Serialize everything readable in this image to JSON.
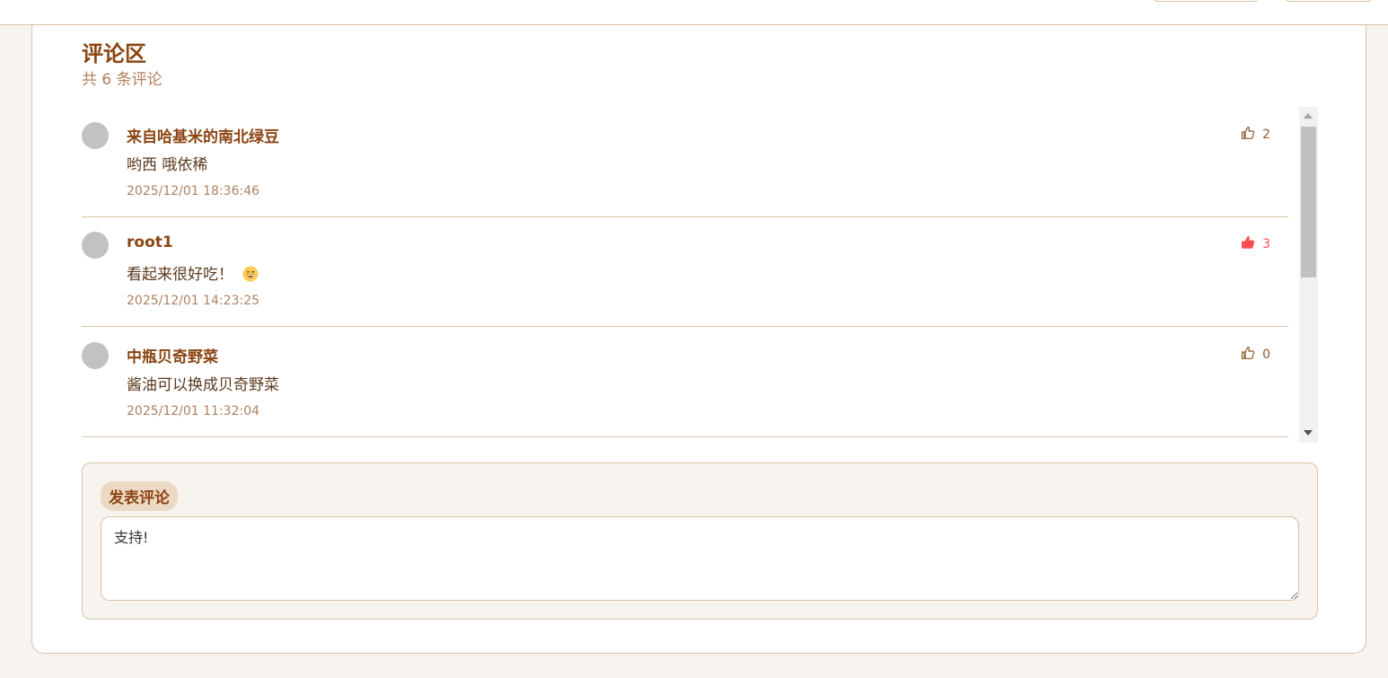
{
  "comments_section": {
    "title": "评论区",
    "count_text": "共 6 条评论",
    "comments": [
      {
        "author": "来自哈基米的南北绿豆",
        "text": "哟西 哦依稀",
        "time": "2025/12/01 18:36:46",
        "likes": "2",
        "liked": false
      },
      {
        "author": "root1",
        "text": "看起来很好吃！",
        "emoji": "grinning-face-emoji",
        "time": "2025/12/01 14:23:25",
        "likes": "3",
        "liked": true
      },
      {
        "author": "中瓶贝奇野菜",
        "text": "酱油可以换成贝奇野菜",
        "time": "2025/12/01 11:32:04",
        "likes": "0",
        "liked": false
      }
    ]
  },
  "compose": {
    "label": "发表评论",
    "value": "支持!"
  },
  "colors": {
    "accent": "#8b4513",
    "liked": "#ff4d4f",
    "border": "#d9c3a5",
    "background": "#f7f3ee"
  }
}
